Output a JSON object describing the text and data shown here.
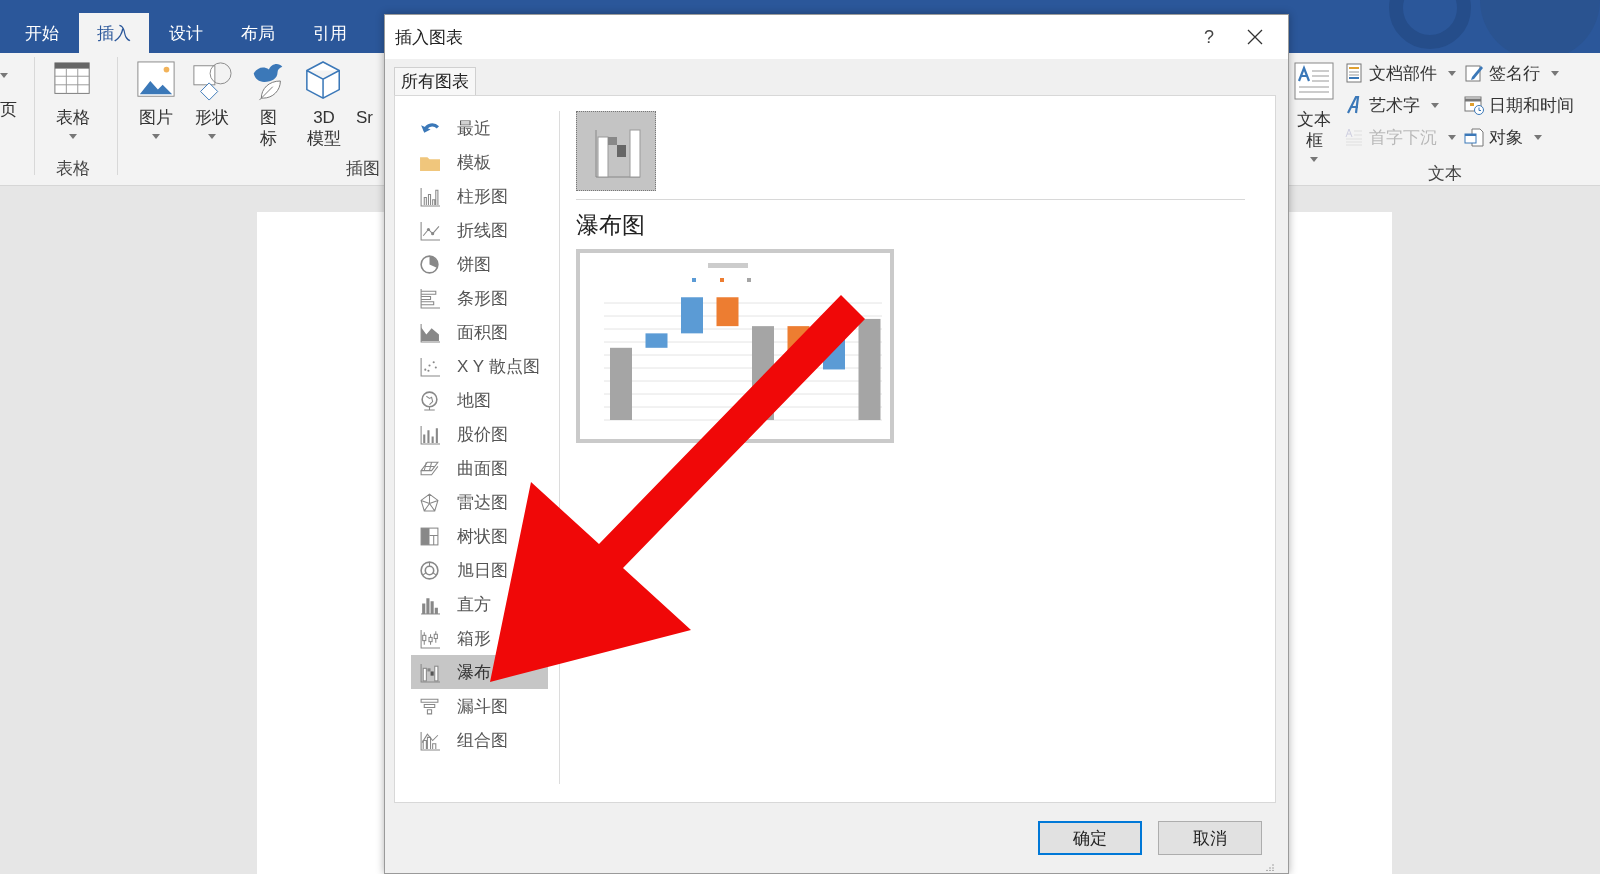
{
  "ribbon": {
    "tabs": [
      {
        "label": "开始",
        "selected": false
      },
      {
        "label": "插入",
        "selected": true
      },
      {
        "label": "设计",
        "selected": false
      },
      {
        "label": "布局",
        "selected": false
      },
      {
        "label": "引用",
        "selected": false
      }
    ],
    "cut_button": {
      "label": "页"
    },
    "groups": [
      {
        "label": "表格",
        "buttons": [
          {
            "label": "表格",
            "kind": "table",
            "dropdown": true
          }
        ]
      },
      {
        "label": "插图",
        "buttons": [
          {
            "label": "图片",
            "kind": "picture",
            "dropdown": true
          },
          {
            "label": "形状",
            "kind": "shapes",
            "dropdown": true
          },
          {
            "label": "图标",
            "kind": "icons",
            "dropdown": false
          },
          {
            "label": "3D 模型",
            "kind": "cube",
            "dropdown": false
          },
          {
            "label": "Sr",
            "kind": "text",
            "dropdown": false
          }
        ]
      }
    ],
    "text_group": {
      "label": "文本",
      "large": {
        "label": "文本框",
        "dropdown": true
      },
      "small": [
        {
          "label": "文档部件",
          "kind": "parts",
          "dropdown": true,
          "disabled": false
        },
        {
          "label": "签名行",
          "kind": "signature",
          "dropdown": true,
          "disabled": false
        },
        {
          "label": "艺术字",
          "kind": "wordart",
          "dropdown": true,
          "disabled": false
        },
        {
          "label": "日期和时间",
          "kind": "date",
          "dropdown": false,
          "disabled": false
        },
        {
          "label": "首字下沉",
          "kind": "dropcap",
          "dropdown": true,
          "disabled": true
        },
        {
          "label": "对象",
          "kind": "object",
          "dropdown": true,
          "disabled": false
        }
      ]
    }
  },
  "dialog": {
    "title": "插入图表",
    "help": "?",
    "tabs": [
      {
        "label": "所有图表",
        "selected": true
      }
    ],
    "categories": [
      {
        "label": "最近",
        "kind": "recent",
        "selected": false
      },
      {
        "label": "模板",
        "kind": "template",
        "selected": false
      },
      {
        "label": "柱形图",
        "kind": "column",
        "selected": false
      },
      {
        "label": "折线图",
        "kind": "line",
        "selected": false
      },
      {
        "label": "饼图",
        "kind": "pie",
        "selected": false
      },
      {
        "label": "条形图",
        "kind": "bar",
        "selected": false
      },
      {
        "label": "面积图",
        "kind": "area",
        "selected": false
      },
      {
        "label": "X Y 散点图",
        "kind": "scatter",
        "selected": false
      },
      {
        "label": "地图",
        "kind": "map",
        "selected": false
      },
      {
        "label": "股价图",
        "kind": "stock",
        "selected": false
      },
      {
        "label": "曲面图",
        "kind": "surface",
        "selected": false
      },
      {
        "label": "雷达图",
        "kind": "radar",
        "selected": false
      },
      {
        "label": "树状图",
        "kind": "treemap",
        "selected": false
      },
      {
        "label": "旭日图",
        "kind": "sunburst",
        "selected": false
      },
      {
        "label": "直方",
        "kind": "histogram",
        "selected": false
      },
      {
        "label": "箱形",
        "kind": "box",
        "selected": false
      },
      {
        "label": "瀑布",
        "kind": "waterfall",
        "selected": true
      },
      {
        "label": "漏斗图",
        "kind": "funnel",
        "selected": false
      },
      {
        "label": "组合图",
        "kind": "combo",
        "selected": false
      }
    ],
    "subtypes": [
      {
        "selected": true
      }
    ],
    "heading": "瀑布图",
    "buttons": [
      {
        "label": "确定",
        "default": true
      },
      {
        "label": "取消",
        "default": false
      }
    ]
  }
}
